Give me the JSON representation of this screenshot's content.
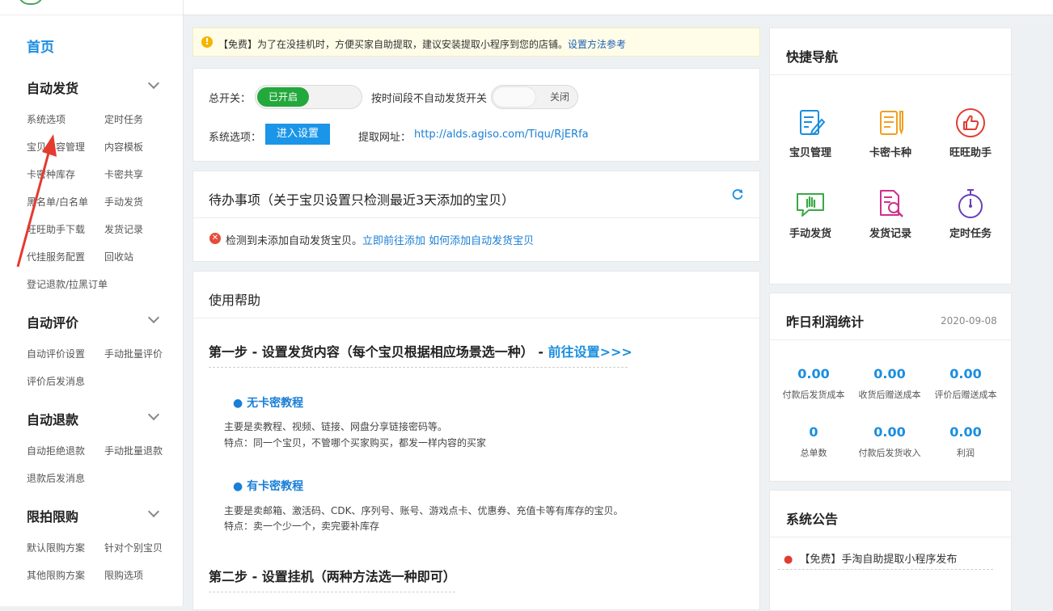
{
  "sidebar": {
    "home": "首页",
    "groups": [
      {
        "title": "自动发货",
        "items": [
          "系统选项",
          "定时任务",
          "宝贝内容管理",
          "内容模板",
          "卡密种库存",
          "卡密共享",
          "黑名单/白名单",
          "手动发货",
          "旺旺助手下载",
          "发货记录",
          "代挂服务配置",
          "回收站",
          "登记退款/拉黑订单"
        ]
      },
      {
        "title": "自动评价",
        "items": [
          "自动评价设置",
          "手动批量评价",
          "评价后发消息"
        ]
      },
      {
        "title": "自动退款",
        "items": [
          "自动拒绝退款",
          "手动批量退款",
          "退款后发消息"
        ]
      },
      {
        "title": "限拍限购",
        "items": [
          "默认限购方案",
          "针对个别宝贝",
          "其他限购方案",
          "限购选项"
        ]
      }
    ]
  },
  "notice": {
    "text": "【免费】为了在没挂机时，方便买家自助提取，建议安装提取小程序到您的店铺。",
    "link": "设置方法参考"
  },
  "switches": {
    "master_label": "总开关：",
    "master_state": "已开启",
    "timed_label": "按时间段不自动发货开关",
    "timed_state": "关闭",
    "system_label": "系统选项：",
    "system_button": "进入设置",
    "url_label": "提取网址：",
    "url_value": "http://alds.agiso.com/Tiqu/RjERfa"
  },
  "todo": {
    "title": "待办事项（关于宝贝设置只检测最近3天添加的宝贝）",
    "message": "检测到未添加自动发货宝贝。",
    "link1": "立即前往添加",
    "link2": "如何添加自动发货宝贝"
  },
  "help": {
    "title": "使用帮助",
    "step1": "第一步 - 设置发货内容（每个宝贝根据相应场景选一种） - ",
    "step1_link": "前往设置>>>",
    "sections": [
      {
        "title": "● 无卡密教程",
        "line1": "主要是卖教程、视频、链接、网盘分享链接密码等。",
        "line2": "特点：同一个宝贝，不管哪个买家购买，都发一样内容的买家"
      },
      {
        "title": "● 有卡密教程",
        "line1": "主要是卖邮箱、激活码、CDK、序列号、账号、游戏点卡、优惠券、充值卡等有库存的宝贝。",
        "line2": "特点：卖一个少一个，卖完要补库存"
      }
    ],
    "step2": "第二步 - 设置挂机（两种方法选一种即可）"
  },
  "quick_nav": {
    "title": "快捷导航",
    "items": [
      {
        "label": "宝贝管理",
        "icon": "edit-document-icon",
        "color": "#1a8ee0"
      },
      {
        "label": "卡密卡种",
        "icon": "notepad-pen-icon",
        "color": "#f0a020"
      },
      {
        "label": "旺旺助手",
        "icon": "thumbs-up-icon",
        "color": "#e03c31"
      },
      {
        "label": "手动发货",
        "icon": "hand-chat-icon",
        "color": "#3aa845"
      },
      {
        "label": "发货记录",
        "icon": "search-document-icon",
        "color": "#d0308a"
      },
      {
        "label": "定时任务",
        "icon": "stopwatch-icon",
        "color": "#6a3fb8"
      }
    ]
  },
  "profit": {
    "title": "昨日利润统计",
    "date": "2020-09-08",
    "stats": [
      {
        "value": "0.00",
        "label": "付款后发货成本"
      },
      {
        "value": "0.00",
        "label": "收货后赠送成本"
      },
      {
        "value": "0.00",
        "label": "评价后赠送成本"
      },
      {
        "value": "0",
        "label": "总单数"
      },
      {
        "value": "0.00",
        "label": "付款后发货收入"
      },
      {
        "value": "0.00",
        "label": "利润"
      }
    ]
  },
  "announcement": {
    "title": "系统公告",
    "items": [
      "【免费】手淘自助提取小程序发布"
    ]
  }
}
